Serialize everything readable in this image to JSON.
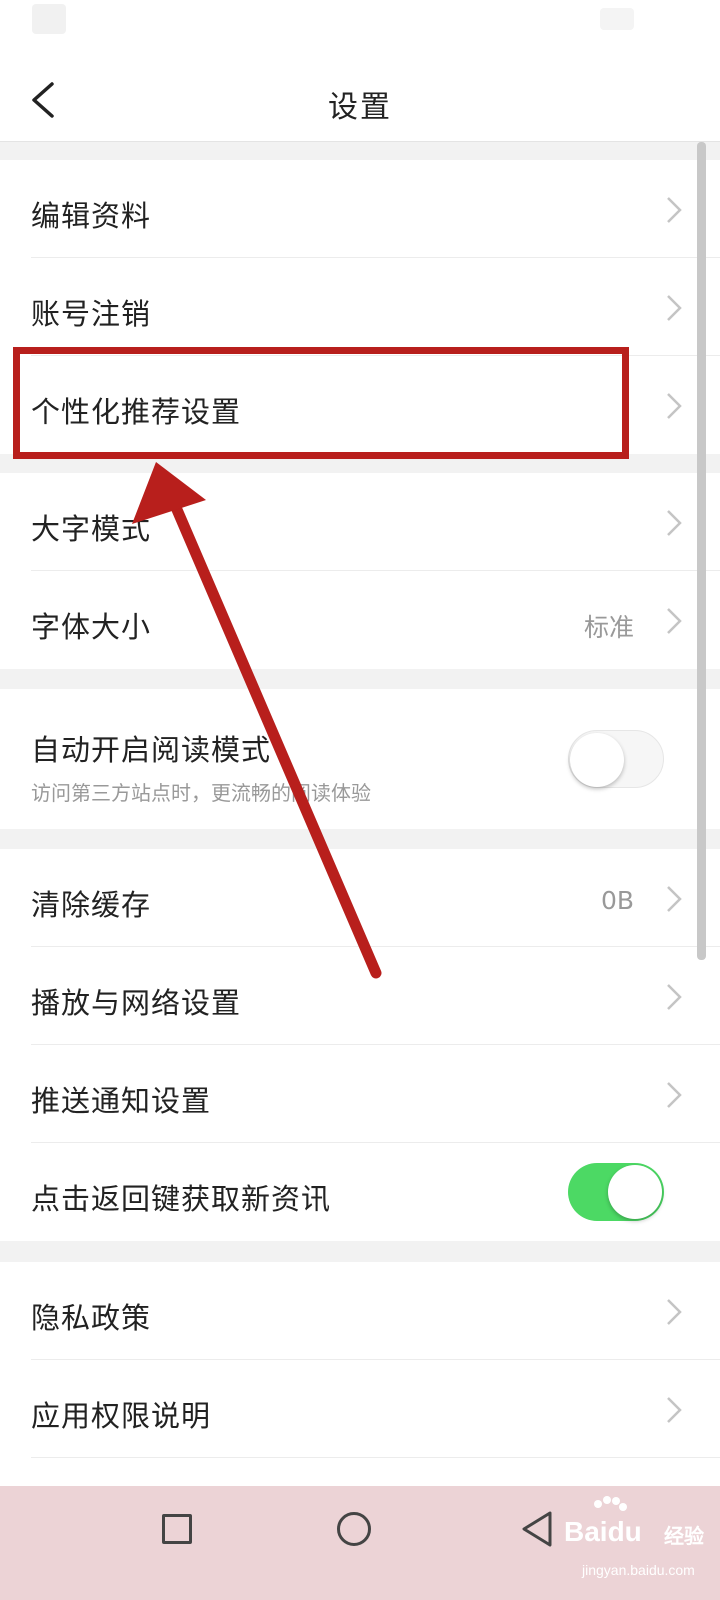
{
  "header": {
    "title": "设置"
  },
  "groups": [
    {
      "rows": [
        {
          "label": "编辑资料"
        },
        {
          "label": "账号注销"
        },
        {
          "label": "个性化推荐设置"
        }
      ]
    },
    {
      "rows": [
        {
          "label": "大字模式"
        },
        {
          "label": "字体大小",
          "value": "标准"
        }
      ]
    },
    {
      "rows": [
        {
          "label": "自动开启阅读模式",
          "sublabel": "访问第三方站点时，更流畅的阅读体验",
          "toggle": "off"
        }
      ]
    },
    {
      "rows": [
        {
          "label": "清除缓存",
          "value": "0B"
        },
        {
          "label": "播放与网络设置"
        },
        {
          "label": "推送通知设置"
        },
        {
          "label": "点击返回键获取新资讯",
          "toggle": "on"
        }
      ]
    },
    {
      "rows": [
        {
          "label": "隐私政策"
        },
        {
          "label": "应用权限说明"
        }
      ]
    }
  ],
  "annotation": {
    "color": "#b81f1c",
    "highlighted_item": "个性化推荐设置"
  },
  "colors": {
    "toggle_on": "#4cd964",
    "background": "#f2f2f2"
  },
  "icons": {
    "back": "chevron-left-icon",
    "row": "chevron-right-icon"
  },
  "watermark": {
    "brand": "Baidu",
    "product": "经验",
    "url": "jingyan.baidu.com"
  }
}
